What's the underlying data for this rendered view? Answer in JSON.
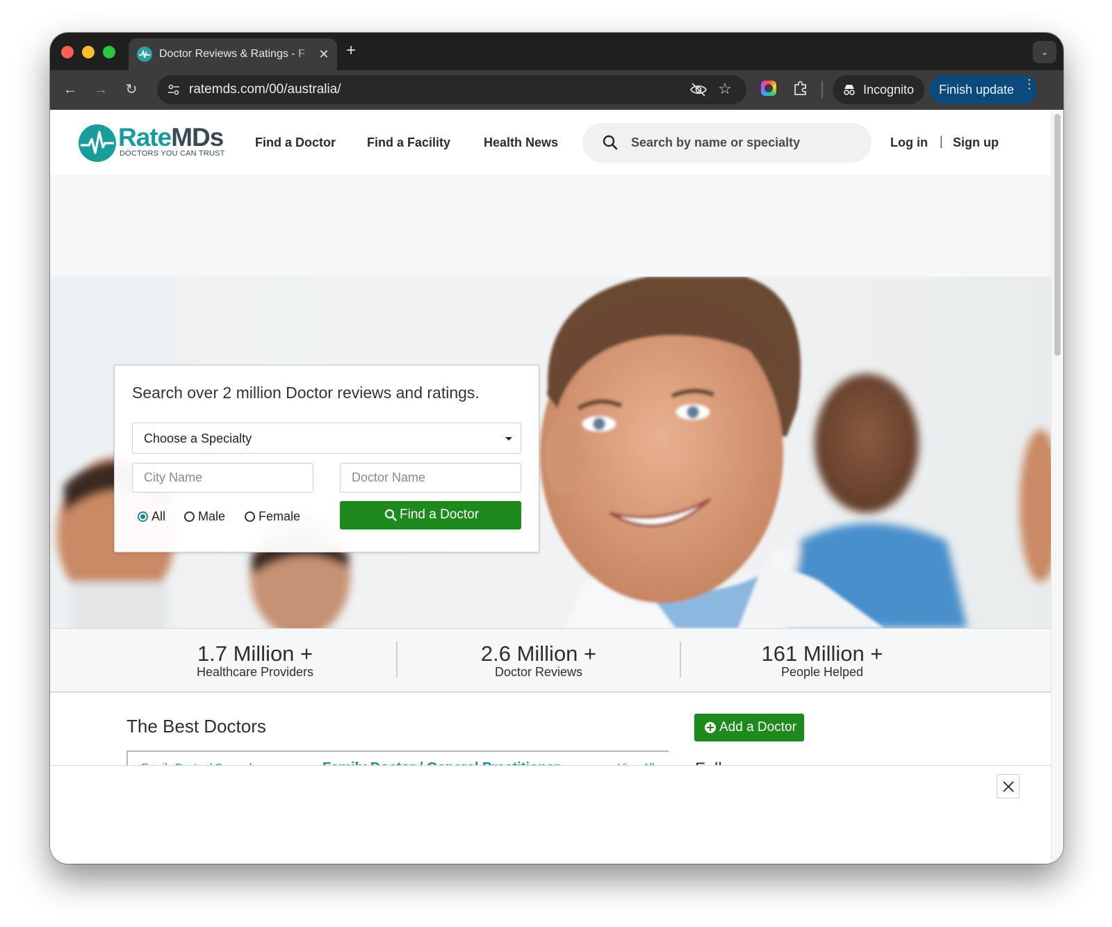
{
  "browser": {
    "tab_title": "Doctor Reviews & Ratings - F",
    "tab_close_glyph": "✕",
    "new_tab_glyph": "+",
    "dropdown_glyph": "⌄",
    "back_glyph": "←",
    "forward_glyph": "→",
    "reload_glyph": "↻",
    "url": "ratemds.com/00/australia/",
    "star_glyph": "☆",
    "incognito_label": "Incognito",
    "finish_update_label": "Finish update",
    "kebab_glyph": "⋮"
  },
  "header": {
    "logo_rate": "Rate",
    "logo_mds": "MDs",
    "logo_tagline": "DOCTORS YOU CAN TRUST",
    "nav": [
      "Find a Doctor",
      "Find a Facility",
      "Health News"
    ],
    "search_placeholder": "Search by name or specialty",
    "login": "Log in",
    "separator": "|",
    "signup": "Sign up"
  },
  "search_card": {
    "title": "Search over 2 million Doctor reviews and ratings.",
    "specialty_value": "Choose a Specialty",
    "city_placeholder": "City Name",
    "doctor_placeholder": "Doctor Name",
    "gender_options": [
      "All",
      "Male",
      "Female"
    ],
    "gender_selected": "All",
    "find_button": "Find a Doctor"
  },
  "stats": [
    {
      "value": "1.7 Million +",
      "label": "Healthcare Providers"
    },
    {
      "value": "2.6 Million +",
      "label": "Doctor Reviews"
    },
    {
      "value": "161 Million +",
      "label": "People Helped"
    }
  ],
  "best_doctors": {
    "title": "The Best Doctors",
    "side_item": "Family Doctor / General",
    "panel_heading": "Family Doctor / General Practitioner",
    "view_all": "View All"
  },
  "sidebar": {
    "add_doctor": "Add a Doctor",
    "follow_us": "Follow us"
  },
  "colors": {
    "brand_teal": "#1a9c9c",
    "brand_dark": "#3a4a55",
    "action_green": "#1e8a1e",
    "link_teal": "#1a8a95"
  }
}
